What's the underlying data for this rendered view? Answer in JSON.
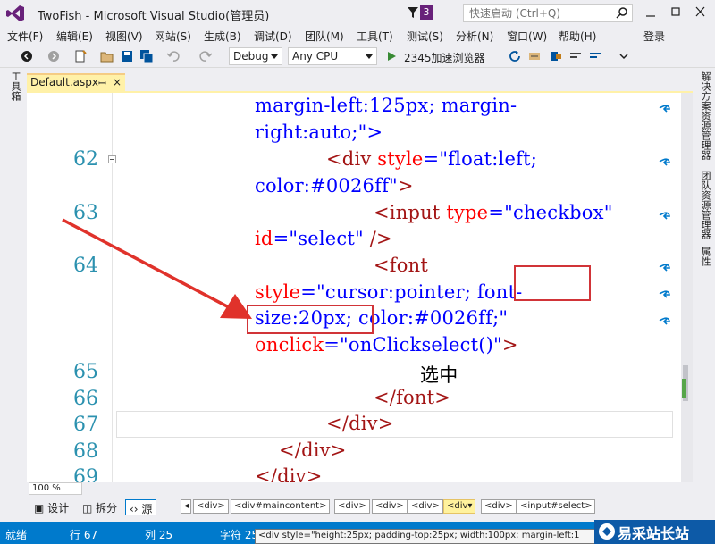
{
  "title_bar": {
    "title": "TwoFish - Microsoft Visual Studio(管理员)",
    "notification_count": "3",
    "quick_launch_placeholder": "快速启动 (Ctrl+Q)"
  },
  "menu": {
    "items": [
      "文件(F)",
      "编辑(E)",
      "视图(V)",
      "网站(S)",
      "生成(B)",
      "调试(D)",
      "团队(M)",
      "工具(T)",
      "测试(S)",
      "分析(N)",
      "窗口(W)",
      "帮助(H)"
    ],
    "login": "登录"
  },
  "toolbar": {
    "configuration": "Debug",
    "platform": "Any CPU",
    "run_target": "2345加速浏览器"
  },
  "left_panel": {
    "toolbox_label": "工具箱"
  },
  "right_panel": {
    "labels": [
      "解决方案资源管理器",
      "团队资源管理器",
      "属性"
    ]
  },
  "document_tab": {
    "name": "Default.aspx",
    "pin": "ꟷ",
    "close": "×"
  },
  "editor": {
    "line_numbers": [
      "62",
      "63",
      "64",
      "65",
      "66",
      "67",
      "68",
      "69"
    ],
    "lines": {
      "l1": "margin-left:125px; margin-",
      "l2": "right:auto;\">",
      "l3_lt": "<",
      "l3_tag": "div",
      "l3_attr": " style",
      "l3_val": "=\"float:left;",
      "l4_val": "color:#0026ff\"",
      "l4_gt": ">",
      "l5_lt": "<",
      "l5_tag": "input",
      "l5_attr": " type",
      "l5_val": "=\"checkbox\"",
      "l6_attr": "id",
      "l6_val": "=\"select\"",
      "l6_gt": "  />",
      "l7_lt": "<",
      "l7_tag": "font",
      "l8_attr": "style",
      "l8_val": "=\"cursor:pointer; font-",
      "l9_val": "size:20px; color:#0026ff;\"",
      "l10_attr": "onclick",
      "l10_val": "=\"onClickselect()\"",
      "l10_gt": ">",
      "l11": "选中",
      "l12_lt": "</",
      "l12_tag": "font",
      "l12_gt": ">",
      "l13_lt": "</",
      "l13_tag": "div",
      "l13_gt": ">",
      "l14_lt": "</",
      "l14_tag": "div",
      "l14_gt": ">",
      "l15_lt": "</",
      "l15_tag": "div",
      "l15_gt": ">"
    }
  },
  "bottom_bar": {
    "zoom": "100 %",
    "view_design": "设计",
    "view_split": "拆分",
    "view_source": "源",
    "breadcrumbs": [
      "<div>",
      "<div#maincontent>",
      "<div>",
      "<div>",
      "<div>",
      "<div▾",
      "<div>",
      "<input#select>"
    ]
  },
  "status_bar": {
    "ready": "就绪",
    "line": "行 67",
    "col": "列 25",
    "char": "字符 25",
    "tooltip": "<div style=\"height:25px; padding-top:25px; width:100px; margin-left:1"
  },
  "watermark": {
    "text": "易采站长站"
  },
  "colors": {
    "accent": "#68217a",
    "status_bar": "#007acc",
    "annotation_red": "#d13438"
  }
}
